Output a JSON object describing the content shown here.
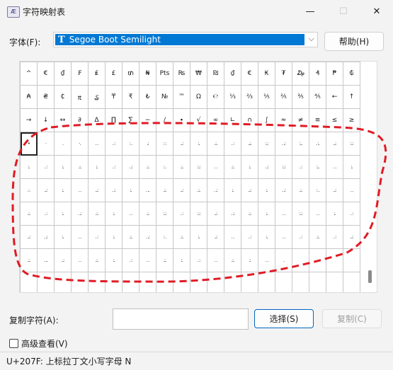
{
  "window": {
    "title": "字符映射表",
    "icon": "charmap-app-icon",
    "minimize_glyph": "—",
    "maximize_glyph": "☐",
    "close_glyph": "✕"
  },
  "font": {
    "label": "字体(F):",
    "selected": "Segoe Boot Semilight",
    "type_glyph": "T",
    "dropdown_glyph": "⌵"
  },
  "help_button": "帮助(H)",
  "grid": {
    "rows": [
      [
        "^",
        "€",
        "₫",
        "₣",
        "₤",
        "£",
        "₥",
        "₦",
        "Pts",
        "₨",
        "₩",
        "₪",
        "₫",
        "€",
        "₭",
        "₮",
        "₯",
        "₰",
        "₱",
        "₲"
      ],
      [
        "₳",
        "₴",
        "₵",
        "₶",
        "₷",
        "₸",
        "₹",
        "₺",
        "№",
        "™",
        "Ω",
        "℮",
        "⅓",
        "⅔",
        "⅕",
        "⅖",
        "⅗",
        "⅘",
        "←",
        "↑"
      ],
      [
        "→",
        "↓",
        "↔",
        "∂",
        "∆",
        "∏",
        "∑",
        "−",
        "∕",
        "∙",
        "√",
        "∞",
        "∟",
        "∩",
        "∫",
        "≈",
        "≠",
        "≡",
        "≤",
        "≥"
      ],
      [
        "•",
        "·",
        ".",
        "·.",
        ". .",
        ". :",
        ": .",
        ".:",
        ": :",
        "..:",
        ":.",
        ".:.",
        ". :",
        "..:.",
        ":.:",
        ". .:",
        ":..",
        ". :.",
        "..:",
        ":.:"
      ],
      [
        ":.",
        ". :",
        ":.",
        ".:.",
        ":.",
        ". :",
        ". .:",
        ".:.",
        ": .",
        ".:.",
        ":.:",
        ". .",
        ".:.",
        ":.",
        ". .:",
        ":.:",
        ". :",
        ":..",
        ". .",
        ":."
      ],
      [
        ".·.",
        "..:",
        ":.",
        ". .",
        "..:",
        ". .:",
        ":.",
        ". ..",
        ".:.",
        "..:",
        ".:.",
        ". .:",
        ":.",
        "..:",
        ":.",
        ". .:",
        ".:.",
        ": .",
        "..:",
        ". ."
      ],
      [
        ".:.",
        ". :",
        ":.",
        ". .:",
        ".:.",
        ":.",
        ". .",
        ".:.",
        ":.:",
        ". :",
        ":.:",
        "..:",
        ". .:",
        ".:.",
        ":.",
        ". .",
        ":.:",
        ". .",
        ":.",
        ". :"
      ],
      [
        "..:",
        ". .:",
        ":.",
        ". .",
        ". :",
        ":.",
        ".:.",
        ". .:",
        ": .",
        ".:.",
        ":.",
        "..:",
        ". .",
        ". :",
        ":.",
        ". .",
        ". :",
        ".:.",
        ". :",
        "..:"
      ],
      [
        ".:.",
        ". ..",
        "..:",
        ". .",
        ".:.",
        ":.",
        ". :",
        ". .",
        ".:.",
        ":.",
        ". :",
        ". .",
        ".:.",
        ".:",
        ". .",
        ".",
        "",
        "",
        "",
        ""
      ],
      [
        "",
        "",
        "",
        "",
        "",
        "",
        "",
        "",
        "",
        "",
        "",
        "",
        "",
        "",
        "",
        "",
        "",
        "",
        "",
        ""
      ]
    ],
    "selected_index": 60
  },
  "copy": {
    "label": "复制字符(A):",
    "value": "",
    "select_button": "选择(S)",
    "copy_button": "复制(C)"
  },
  "advanced": {
    "label": "高级查看(V)",
    "checked": false
  },
  "status": "U+207F: 上标拉丁文小写字母 N",
  "colors": {
    "selection": "#0078d4",
    "annotation": "#e01b24",
    "window_bg": "#f3f3f3"
  }
}
